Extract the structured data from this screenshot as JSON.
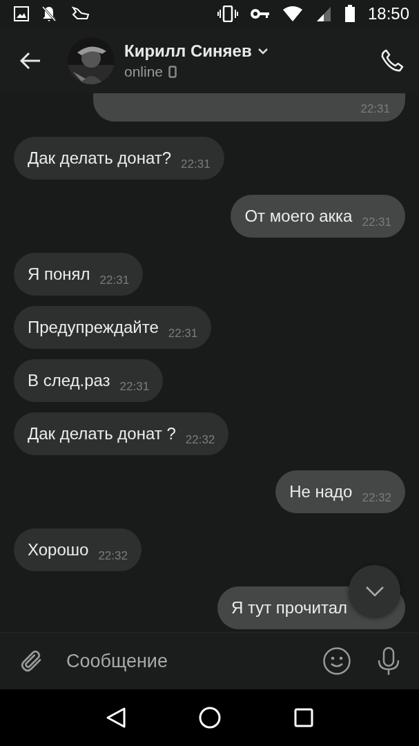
{
  "status_bar": {
    "time": "18:50"
  },
  "header": {
    "name": "Кирилл Синяев",
    "status": "online"
  },
  "messages": [
    {
      "kind": "outgoing",
      "time": "22:31",
      "cut": true
    },
    {
      "kind": "incoming",
      "text": "Дак делать донат?",
      "time": "22:31"
    },
    {
      "kind": "outgoing",
      "text": "От моего акка",
      "time": "22:31"
    },
    {
      "kind": "incoming",
      "text": "Я понял",
      "time": "22:31"
    },
    {
      "kind": "incoming",
      "text": "Предупреждайте",
      "time": "22:31"
    },
    {
      "kind": "incoming",
      "text": "В след.раз",
      "time": "22:31"
    },
    {
      "kind": "incoming",
      "text": "Дак делать донат ?",
      "time": "22:32"
    },
    {
      "kind": "outgoing",
      "text": "Не надо",
      "time": "22:32"
    },
    {
      "kind": "incoming",
      "text": "Хорошо",
      "time": "22:32"
    },
    {
      "kind": "outgoing",
      "text": "Я тут прочитал"
    }
  ],
  "composer": {
    "placeholder": "Сообщение"
  }
}
